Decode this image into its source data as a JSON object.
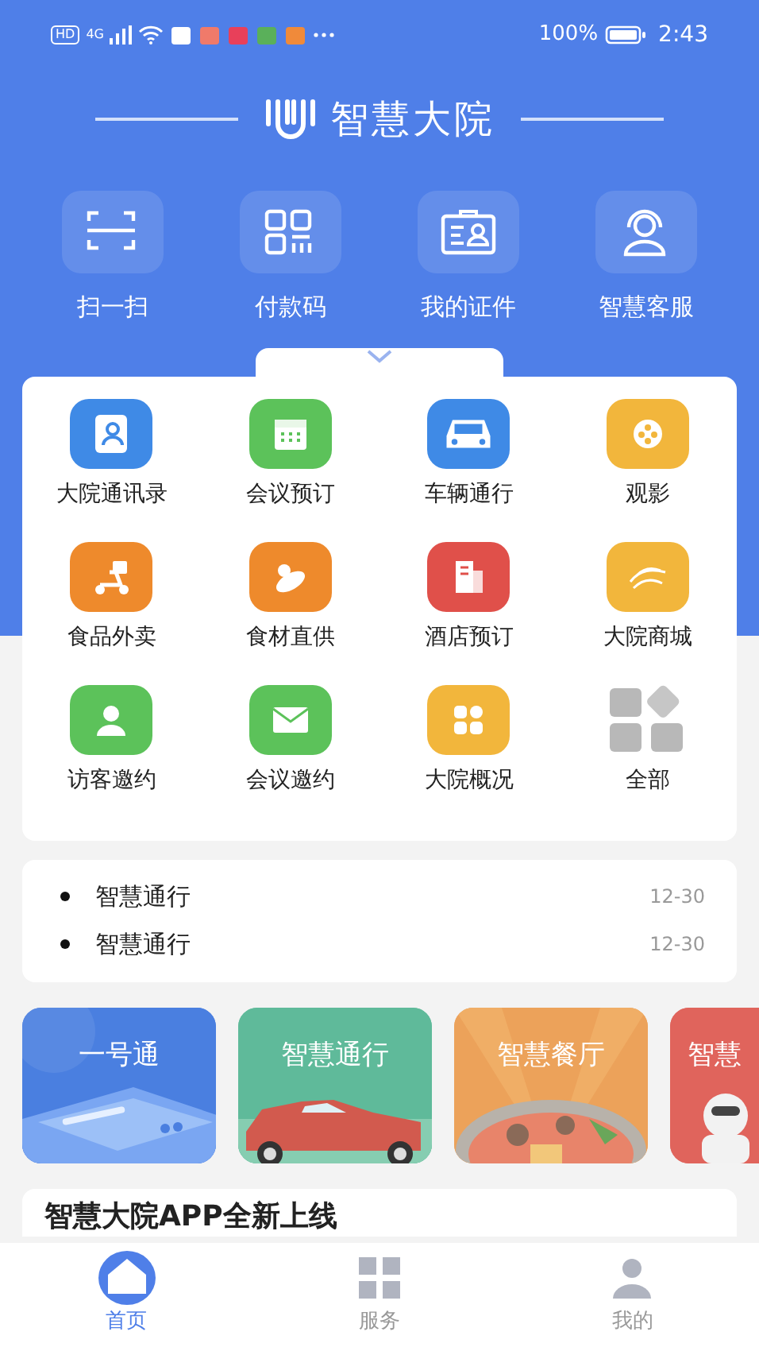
{
  "status_bar": {
    "hd": "HD",
    "network": "4G",
    "battery_text": "100%",
    "time": "2:43"
  },
  "header": {
    "title": "智慧大院"
  },
  "quick_actions": [
    {
      "label": "扫一扫"
    },
    {
      "label": "付款码"
    },
    {
      "label": "我的证件"
    },
    {
      "label": "智慧客服"
    }
  ],
  "services": [
    {
      "label": "大院通讯录",
      "color": "#3f8ae6"
    },
    {
      "label": "会议预订",
      "color": "#5cc25a"
    },
    {
      "label": "车辆通行",
      "color": "#3f8ae6"
    },
    {
      "label": "观影",
      "color": "#f2b63c"
    },
    {
      "label": "食品外卖",
      "color": "#ee8a2c"
    },
    {
      "label": "食材直供",
      "color": "#ee8a2c"
    },
    {
      "label": "酒店预订",
      "color": "#e0504a"
    },
    {
      "label": "大院商城",
      "color": "#f2b63c"
    },
    {
      "label": "访客邀约",
      "color": "#5cc25a"
    },
    {
      "label": "会议邀约",
      "color": "#5cc25a"
    },
    {
      "label": "大院概况",
      "color": "#f2b63c"
    },
    {
      "label": "全部",
      "color": "#b8b8b8"
    }
  ],
  "notices": [
    {
      "title": "智慧通行",
      "date": "12-30"
    },
    {
      "title": "智慧通行",
      "date": "12-30"
    }
  ],
  "feature_cards": [
    {
      "label": "一号通",
      "color": "#4a7fe0"
    },
    {
      "label": "智慧通行",
      "color": "#5fba9a"
    },
    {
      "label": "智慧餐厅",
      "color": "#eca25a"
    },
    {
      "label": "智慧",
      "color": "#e0645c"
    }
  ],
  "banner": {
    "text": "智慧大院APP全新上线"
  },
  "tab_bar": [
    {
      "label": "首页",
      "selected": true
    },
    {
      "label": "服务",
      "selected": false
    },
    {
      "label": "我的",
      "selected": false
    }
  ]
}
